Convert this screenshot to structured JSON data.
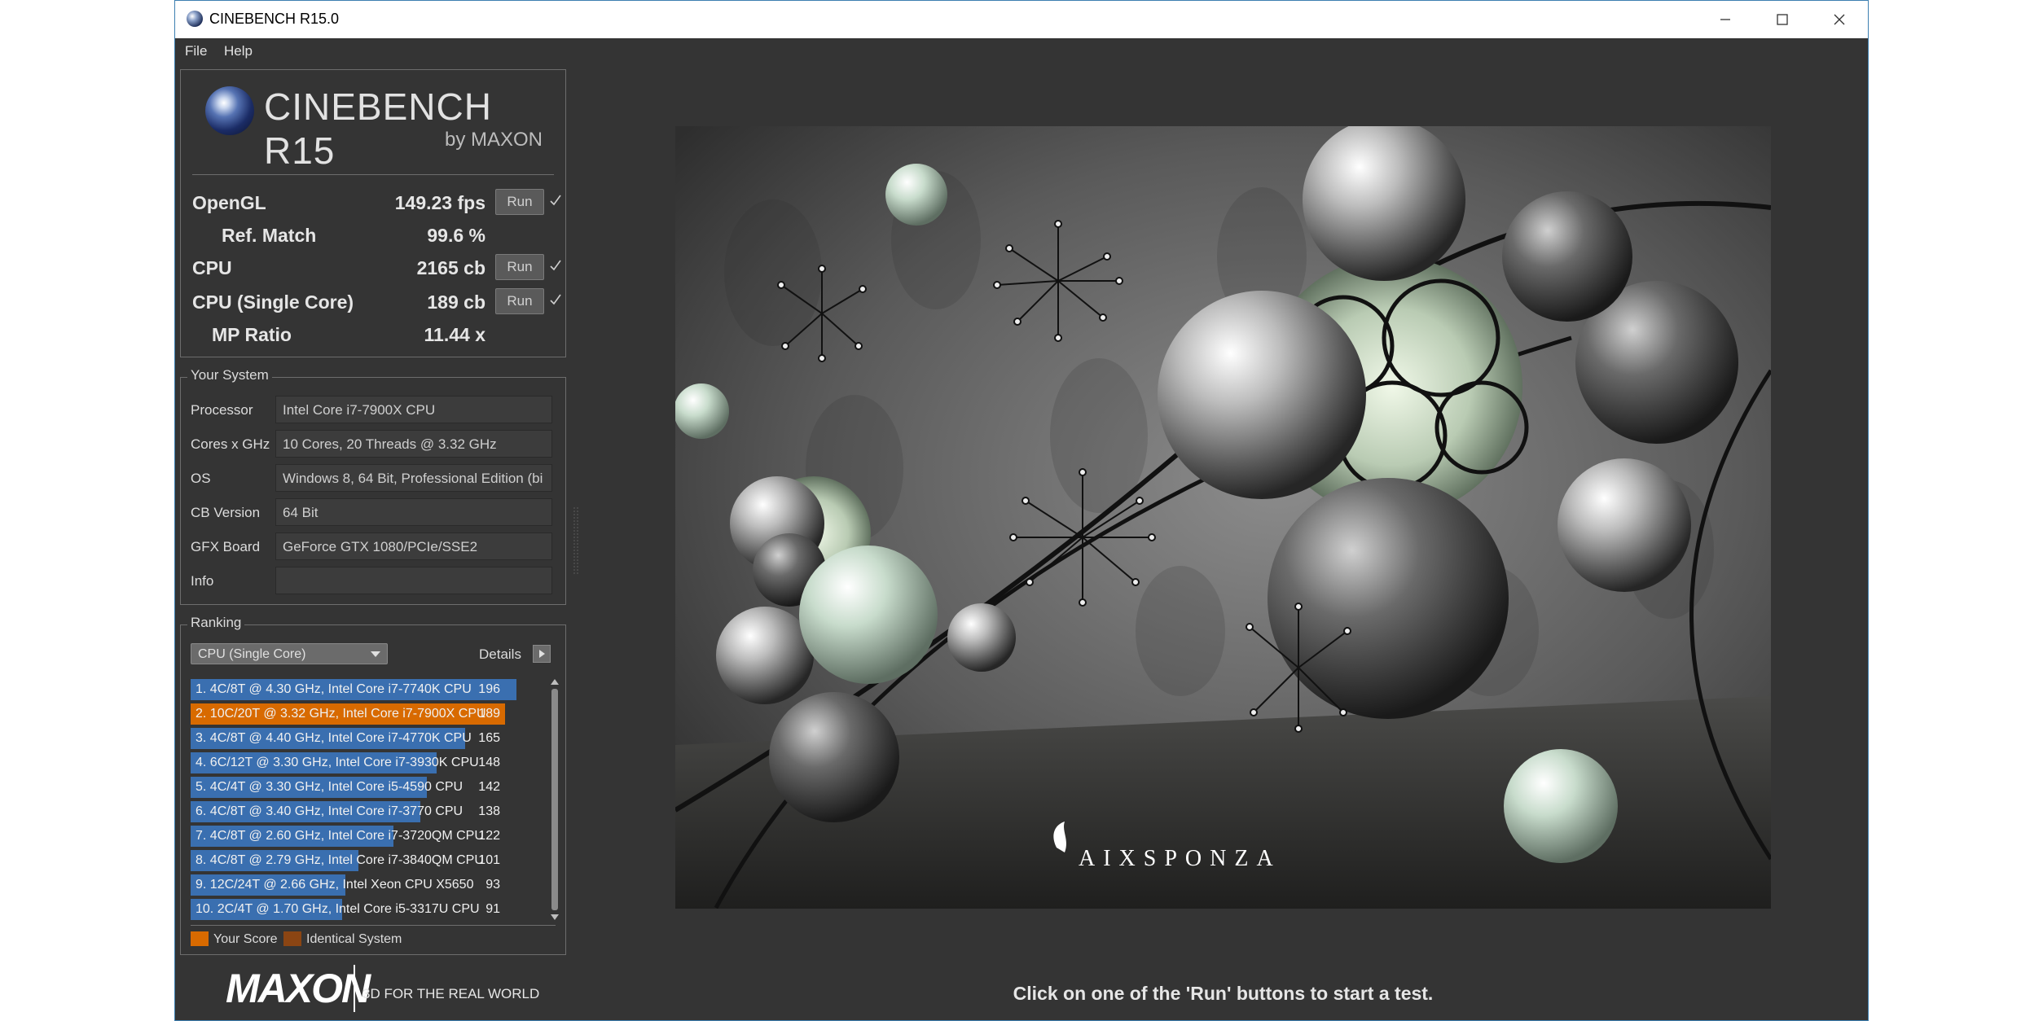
{
  "window": {
    "title": "CINEBENCH R15.0"
  },
  "menu": [
    "File",
    "Help"
  ],
  "logo": {
    "name": "CINEBENCH R15",
    "sub": "by MAXON"
  },
  "results": [
    {
      "label": "OpenGL",
      "value": "149.23 fps",
      "run": "Run",
      "check": true
    },
    {
      "label": "Ref. Match",
      "value": "99.6 %"
    },
    {
      "label": "CPU",
      "value": "2165 cb",
      "run": "Run",
      "check": true
    },
    {
      "label": "CPU (Single Core)",
      "value": "189 cb",
      "run": "Run",
      "check": true
    },
    {
      "label": "MP Ratio",
      "value": "11.44 x"
    }
  ],
  "system": {
    "title": "Your System",
    "rows": [
      {
        "label": "Processor",
        "value": "Intel Core i7-7900X CPU"
      },
      {
        "label": "Cores x GHz",
        "value": "10 Cores, 20 Threads @ 3.32 GHz"
      },
      {
        "label": "OS",
        "value": "Windows 8, 64 Bit, Professional Edition (bi"
      },
      {
        "label": "CB Version",
        "value": "64 Bit"
      },
      {
        "label": "GFX Board",
        "value": "GeForce GTX 1080/PCIe/SSE2"
      },
      {
        "label": "Info",
        "value": ""
      }
    ]
  },
  "ranking": {
    "title": "Ranking",
    "selected": "CPU (Single Core)",
    "details": "Details",
    "items": [
      {
        "text": "1. 4C/8T @ 4.30 GHz, Intel Core i7-7740K CPU",
        "score": "196",
        "value": 196,
        "highlight": false
      },
      {
        "text": "2. 10C/20T @ 3.32 GHz, Intel Core i7-7900X CPU",
        "score": "189",
        "value": 189,
        "highlight": true
      },
      {
        "text": "3. 4C/8T @ 4.40 GHz, Intel Core i7-4770K CPU",
        "score": "165",
        "value": 165,
        "highlight": false
      },
      {
        "text": "4. 6C/12T @ 3.30 GHz,  Intel Core i7-3930K CPU",
        "score": "148",
        "value": 148,
        "highlight": false
      },
      {
        "text": "5. 4C/4T @ 3.30 GHz, Intel Core i5-4590 CPU",
        "score": "142",
        "value": 142,
        "highlight": false
      },
      {
        "text": "6. 4C/8T @ 3.40 GHz,  Intel Core i7-3770 CPU",
        "score": "138",
        "value": 138,
        "highlight": false
      },
      {
        "text": "7. 4C/8T @ 2.60 GHz, Intel Core i7-3720QM CPU",
        "score": "122",
        "value": 122,
        "highlight": false
      },
      {
        "text": "8. 4C/8T @ 2.79 GHz,  Intel Core i7-3840QM CPU",
        "score": "101",
        "value": 101,
        "highlight": false
      },
      {
        "text": "9. 12C/24T @ 2.66 GHz, Intel Xeon CPU X5650",
        "score": "93",
        "value": 93,
        "highlight": false
      },
      {
        "text": "10. 2C/4T @ 1.70 GHz,  Intel Core i5-3317U CPU",
        "score": "91",
        "value": 91,
        "highlight": false
      }
    ],
    "max_value": 196,
    "legend": [
      {
        "label": "Your Score",
        "color": "#d86a00"
      },
      {
        "label": "Identical System",
        "color": "#8b4513"
      }
    ]
  },
  "colors": {
    "bar": "#3a6fb0",
    "highlight": "#d86a00"
  },
  "render": {
    "watermark": "AIXSPONZA"
  },
  "status": "Click on one of the 'Run' buttons to start a test.",
  "footer": {
    "brand": "MAXON",
    "tagline": "3D FOR THE REAL WORLD"
  }
}
